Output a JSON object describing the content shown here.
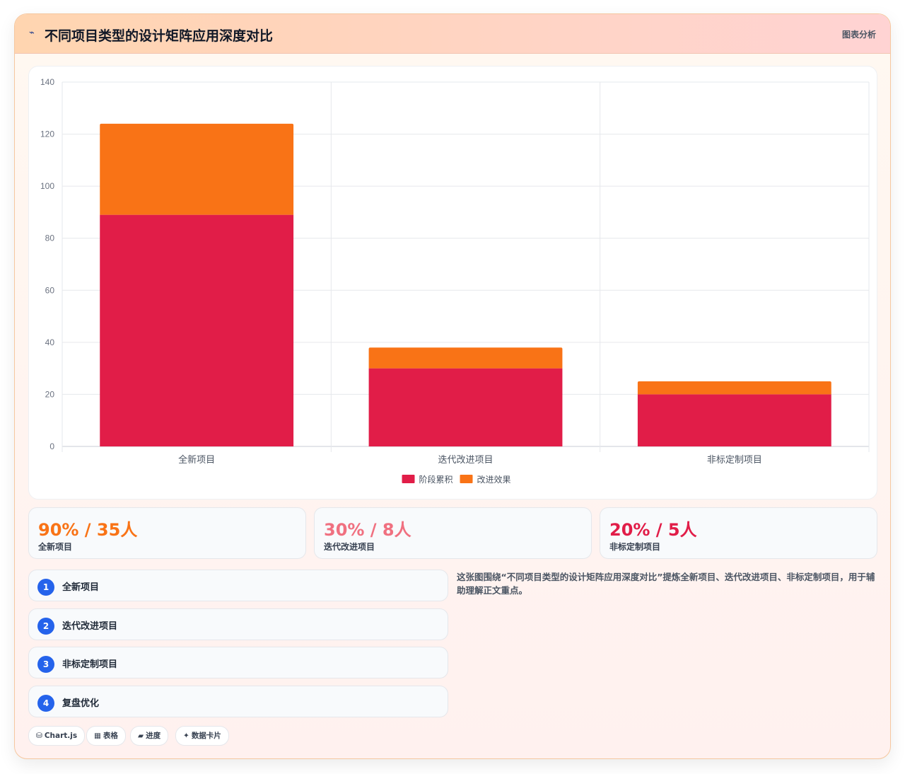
{
  "header": {
    "icon": "chart-line-icon",
    "title": "不同项目类型的设计矩阵应用深度对比",
    "tag": "图表分析"
  },
  "chart_data": {
    "type": "bar",
    "stacked": true,
    "categories": [
      "全新项目",
      "迭代改进项目",
      "非标定制项目"
    ],
    "series": [
      {
        "name": "阶段累积",
        "values": [
          89,
          30,
          20
        ],
        "color": "#e11d48"
      },
      {
        "name": "改进效果",
        "values": [
          35,
          8,
          5
        ],
        "color": "#f97316"
      }
    ],
    "ylim": [
      0,
      140
    ],
    "yticks": [
      0,
      20,
      40,
      60,
      80,
      100,
      120,
      140
    ],
    "grid": true,
    "legend": "bottom-center"
  },
  "stats": [
    {
      "value": "90% / 35人",
      "label": "全新项目",
      "color": "#f97316"
    },
    {
      "value": "30% / 8人",
      "label": "迭代改进项目",
      "color": "#f07080"
    },
    {
      "value": "20% / 5人",
      "label": "非标定制项目",
      "color": "#e11d48"
    }
  ],
  "steps": [
    {
      "num": "1",
      "label": "全新项目"
    },
    {
      "num": "2",
      "label": "迭代改进项目"
    },
    {
      "num": "3",
      "label": "非标定制项目"
    },
    {
      "num": "4",
      "label": "复盘优化"
    }
  ],
  "description": "这张图围绕“不同项目类型的设计矩阵应用深度对比”提炼全新项目、迭代改进项目、非标定制项目，用于辅助理解正文重点。",
  "chips": [
    {
      "icon": "⛁",
      "label": "Chart.js"
    },
    {
      "icon": "▦",
      "label": "表格"
    },
    {
      "icon": "▰",
      "label": "进度"
    },
    {
      "icon": "✦",
      "label": "数据卡片"
    }
  ]
}
